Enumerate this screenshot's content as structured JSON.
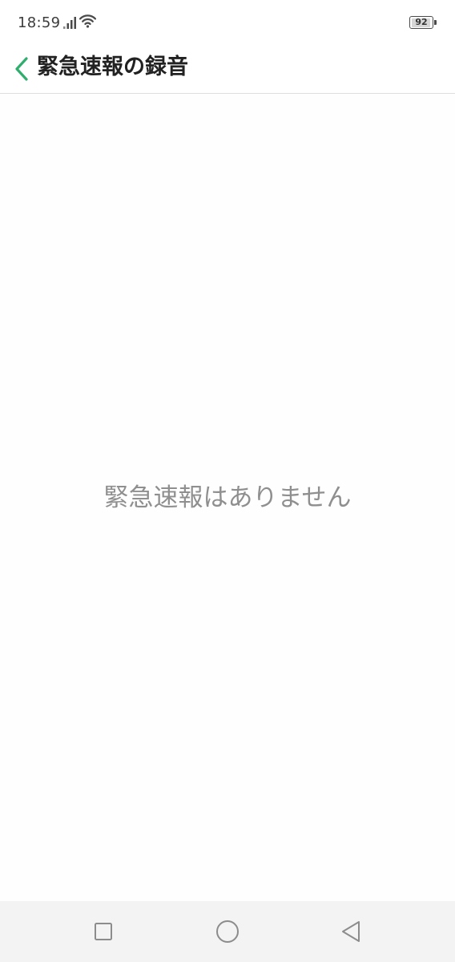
{
  "status_bar": {
    "time": "18:59",
    "battery_level": "92",
    "battery_fraction": 0.92,
    "icons": [
      "signal-icon",
      "wifi-icon",
      "battery-icon"
    ]
  },
  "header": {
    "title": "緊急速報の録音",
    "back_icon": "chevron-left-icon",
    "accent_color": "#2fae6e"
  },
  "main": {
    "empty_message": "緊急速報はありません"
  },
  "nav_bar": {
    "buttons": [
      "recents-square-icon",
      "home-circle-icon",
      "back-triangle-icon"
    ]
  }
}
